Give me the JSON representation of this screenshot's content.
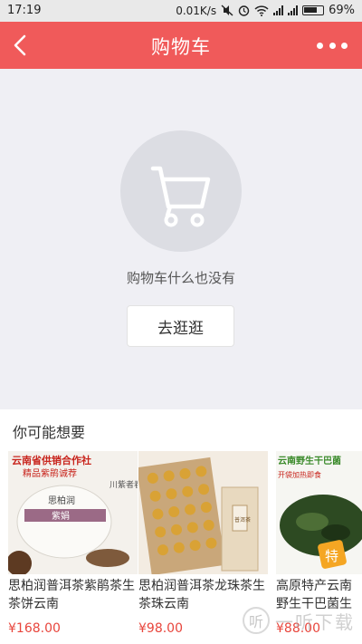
{
  "status_bar": {
    "time": "17:19",
    "network_speed": "0.01K/s",
    "battery": "69%"
  },
  "nav": {
    "title": "购物车",
    "back_icon": "back-arrow-icon",
    "more_icon": "more-dots-icon"
  },
  "empty_state": {
    "icon": "shopping-cart-icon",
    "message": "购物车什么也没有",
    "button_label": "去逛逛"
  },
  "recommend": {
    "title": "你可能想要",
    "products": [
      {
        "name": "思柏润普洱茶紫鹃茶生茶饼云南",
        "price": "¥168.00",
        "image_text": [
          "云南省供销合作社",
          "精品紫鹃诚荐",
          "思柏润",
          "紫娟",
          "川紫者春"
        ]
      },
      {
        "name": "思柏润普洱茶龙珠茶生茶珠云南",
        "price": "¥98.00",
        "image_text": [
          "普洱茶"
        ]
      },
      {
        "name": "高原特产云南野生干巴菌生鲜",
        "price": "¥88.00",
        "image_text": [
          "云南野生干巴菌",
          "开袋加热即食",
          "特"
        ]
      }
    ]
  },
  "watermark": {
    "text": "一听下载"
  },
  "colors": {
    "accent": "#f05a5a",
    "price": "#e8463d"
  }
}
